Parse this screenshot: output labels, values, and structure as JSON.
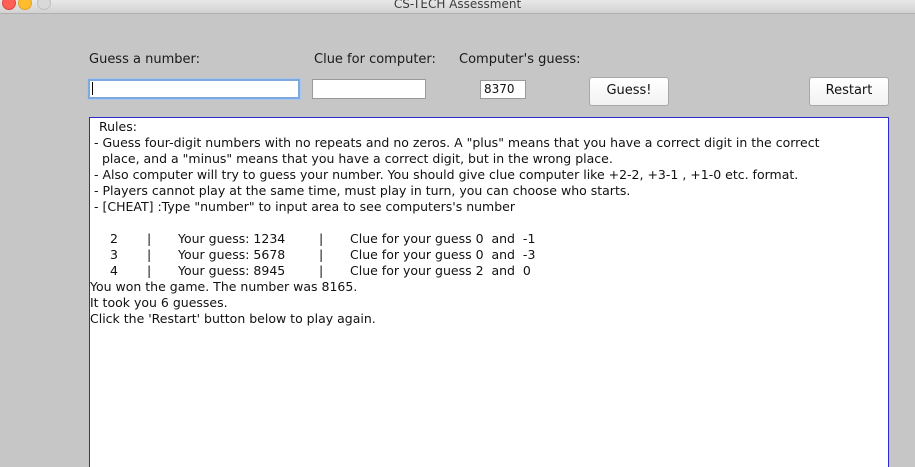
{
  "window": {
    "title": "CS-TECH Assessment"
  },
  "form": {
    "guess_label": "Guess a number:",
    "guess_value": "",
    "clue_label": "Clue for computer:",
    "clue_value": "",
    "computer_guess_label": "Computer's guess:",
    "computer_guess_value": "8370",
    "guess_button": "Guess!",
    "restart_button": "Restart"
  },
  "output": {
    "rules_heading": "Rules:",
    "rules": [
      "- Guess four-digit numbers with no repeats and no zeros. A \"plus\" means that you have a correct digit in the correct",
      "  place, and a \"minus\" means that you have a correct digit, but in the wrong place.",
      "- Also computer will try to guess your number. You should give clue computer like +2-2, +3-1 , +1-0 etc. format.",
      "- Players cannot play at the same time, must play in turn, you can choose who starts.",
      "- [CHEAT] :Type \"number\" to input area to see computers's number"
    ],
    "history": [
      {
        "turn": "2",
        "guess": "Your guess: 1234",
        "clue": "Clue for your guess 0  and  -1"
      },
      {
        "turn": "3",
        "guess": "Your guess: 5678",
        "clue": "Clue for your guess 0  and  -3"
      },
      {
        "turn": "4",
        "guess": "Your guess: 8945",
        "clue": "Clue for your guess 2  and  0"
      }
    ],
    "separator": "|",
    "result_lines": [
      "You won the game. The number was 8165.",
      "It took you 6 guesses.",
      "Click the 'Restart' button below to play again."
    ]
  },
  "colors": {
    "window_bg": "#c6c6c6",
    "focus_ring": "#7fa8dc",
    "output_border": "#2a2ad0"
  }
}
